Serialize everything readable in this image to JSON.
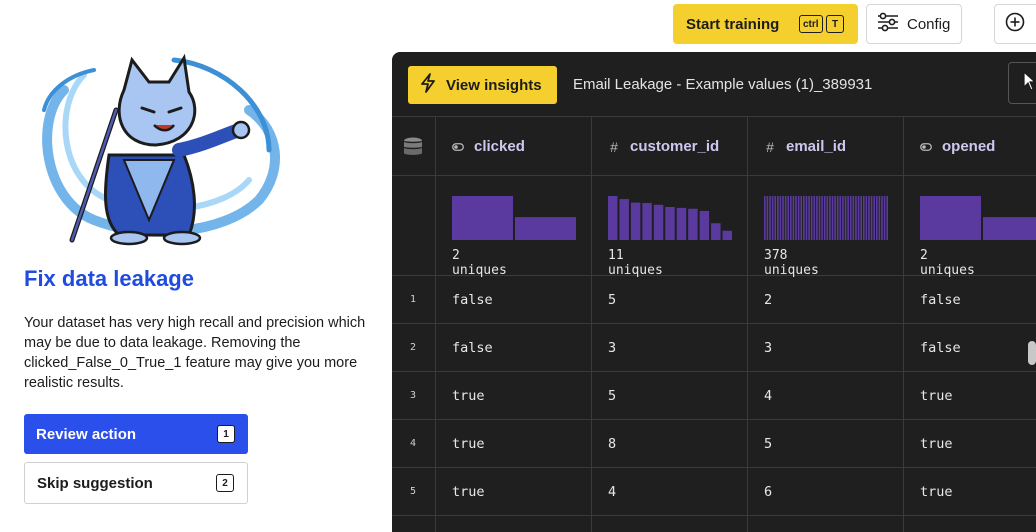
{
  "toolbar": {
    "start_training_label": "Start training",
    "shortcut_ctrl": "ctrl",
    "shortcut_t": "T",
    "config_label": "Config"
  },
  "suggestion": {
    "title": "Fix data leakage",
    "description": "Your dataset has very high recall and precision which may be due to data leakage. Removing the clicked_False_0_True_1 feature may give you more realistic results.",
    "review_label": "Review action",
    "review_shortcut": "1",
    "skip_label": "Skip suggestion",
    "skip_shortcut": "2"
  },
  "panel": {
    "insights_label": "View insights",
    "dataset_name": "Email Leakage - Example values (1)_389931"
  },
  "colors": {
    "accent_yellow": "#f5cf2e",
    "primary_blue": "#2b4fea",
    "title_blue": "#1f4be0",
    "histogram_purple": "#5b3aa0",
    "panel_bg": "#1f1f1f"
  },
  "columns": [
    {
      "name": "clicked",
      "type_icon": "toggle-icon",
      "uniques": "2 uniques",
      "histogram": [
        1.0,
        0.52
      ]
    },
    {
      "name": "customer_id",
      "type_icon": "hash-icon",
      "uniques": "11 uniques",
      "histogram": [
        1.0,
        0.93,
        0.85,
        0.84,
        0.8,
        0.75,
        0.73,
        0.71,
        0.66,
        0.38,
        0.21
      ]
    },
    {
      "name": "email_id",
      "type_icon": "hash-icon",
      "uniques": "378 uniques",
      "histogram_uniform_bins": 48
    },
    {
      "name": "opened",
      "type_icon": "toggle-icon",
      "uniques": "2 uniques",
      "histogram": [
        1.0,
        0.52
      ]
    }
  ],
  "rows": [
    {
      "index": "1",
      "cells": [
        "false",
        "5",
        "2",
        "false"
      ]
    },
    {
      "index": "2",
      "cells": [
        "false",
        "3",
        "3",
        "false"
      ]
    },
    {
      "index": "3",
      "cells": [
        "true",
        "5",
        "4",
        "true"
      ]
    },
    {
      "index": "4",
      "cells": [
        "true",
        "8",
        "5",
        "true"
      ]
    },
    {
      "index": "5",
      "cells": [
        "true",
        "4",
        "6",
        "true"
      ]
    }
  ]
}
